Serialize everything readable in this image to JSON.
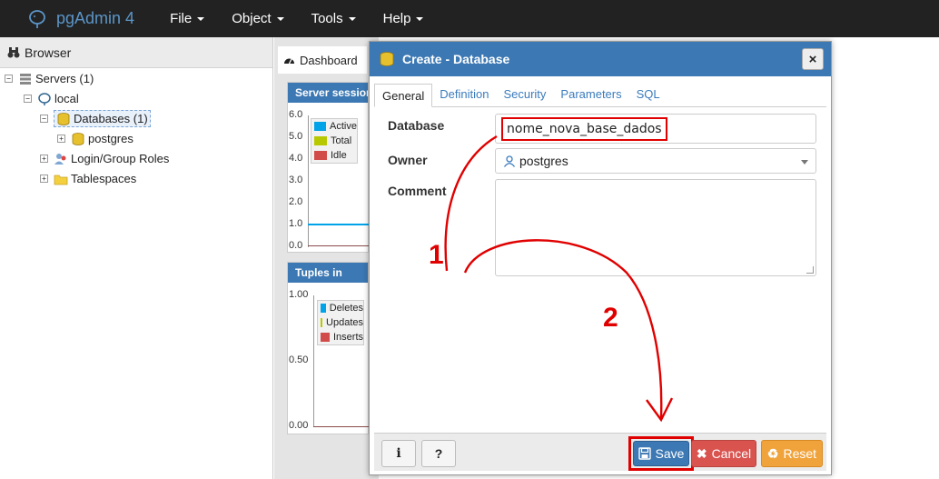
{
  "app": {
    "title": "pgAdmin 4",
    "menu": [
      {
        "label": "File"
      },
      {
        "label": "Object"
      },
      {
        "label": "Tools"
      },
      {
        "label": "Help"
      }
    ]
  },
  "browser": {
    "title": "Browser",
    "tree": {
      "servers": "Servers (1)",
      "local": "local",
      "databases": "Databases (1)",
      "postgres": "postgres",
      "roles": "Login/Group Roles",
      "tablespaces": "Tablespaces"
    }
  },
  "dashboard": {
    "tab_label": "Dashboard",
    "sessions_panel": {
      "title": "Server sessions",
      "ticks": [
        "6.0",
        "5.0",
        "4.0",
        "3.0",
        "2.0",
        "1.0",
        "0.0"
      ],
      "legend": [
        {
          "label": "Active",
          "color": "#00a3e8"
        },
        {
          "label": "Total",
          "color": "#b8c800"
        },
        {
          "label": "Idle",
          "color": "#d24b4b"
        }
      ]
    },
    "tuples_panel": {
      "title": "Tuples in",
      "ticks": [
        "1.00",
        "0.50",
        "0.00"
      ],
      "legend": [
        {
          "label": "Deletes",
          "color": "#00a3e8"
        },
        {
          "label": "Updates",
          "color": "#b8c800"
        },
        {
          "label": "Inserts",
          "color": "#d24b4b"
        }
      ]
    }
  },
  "dialog": {
    "title": "Create - Database",
    "close_symbol": "×",
    "tabs": [
      {
        "label": "General",
        "active": true
      },
      {
        "label": "Definition"
      },
      {
        "label": "Security"
      },
      {
        "label": "Parameters"
      },
      {
        "label": "SQL"
      }
    ],
    "fields": {
      "database_label": "Database",
      "database_value": "nome_nova_base_dados",
      "owner_label": "Owner",
      "owner_value": "postgres",
      "comment_label": "Comment"
    },
    "buttons": {
      "info": "i",
      "help": "?",
      "save": "Save",
      "cancel": "Cancel",
      "reset": "Reset"
    }
  },
  "annotations": {
    "step1": "1",
    "step2": "2",
    "color": "#e00000"
  }
}
